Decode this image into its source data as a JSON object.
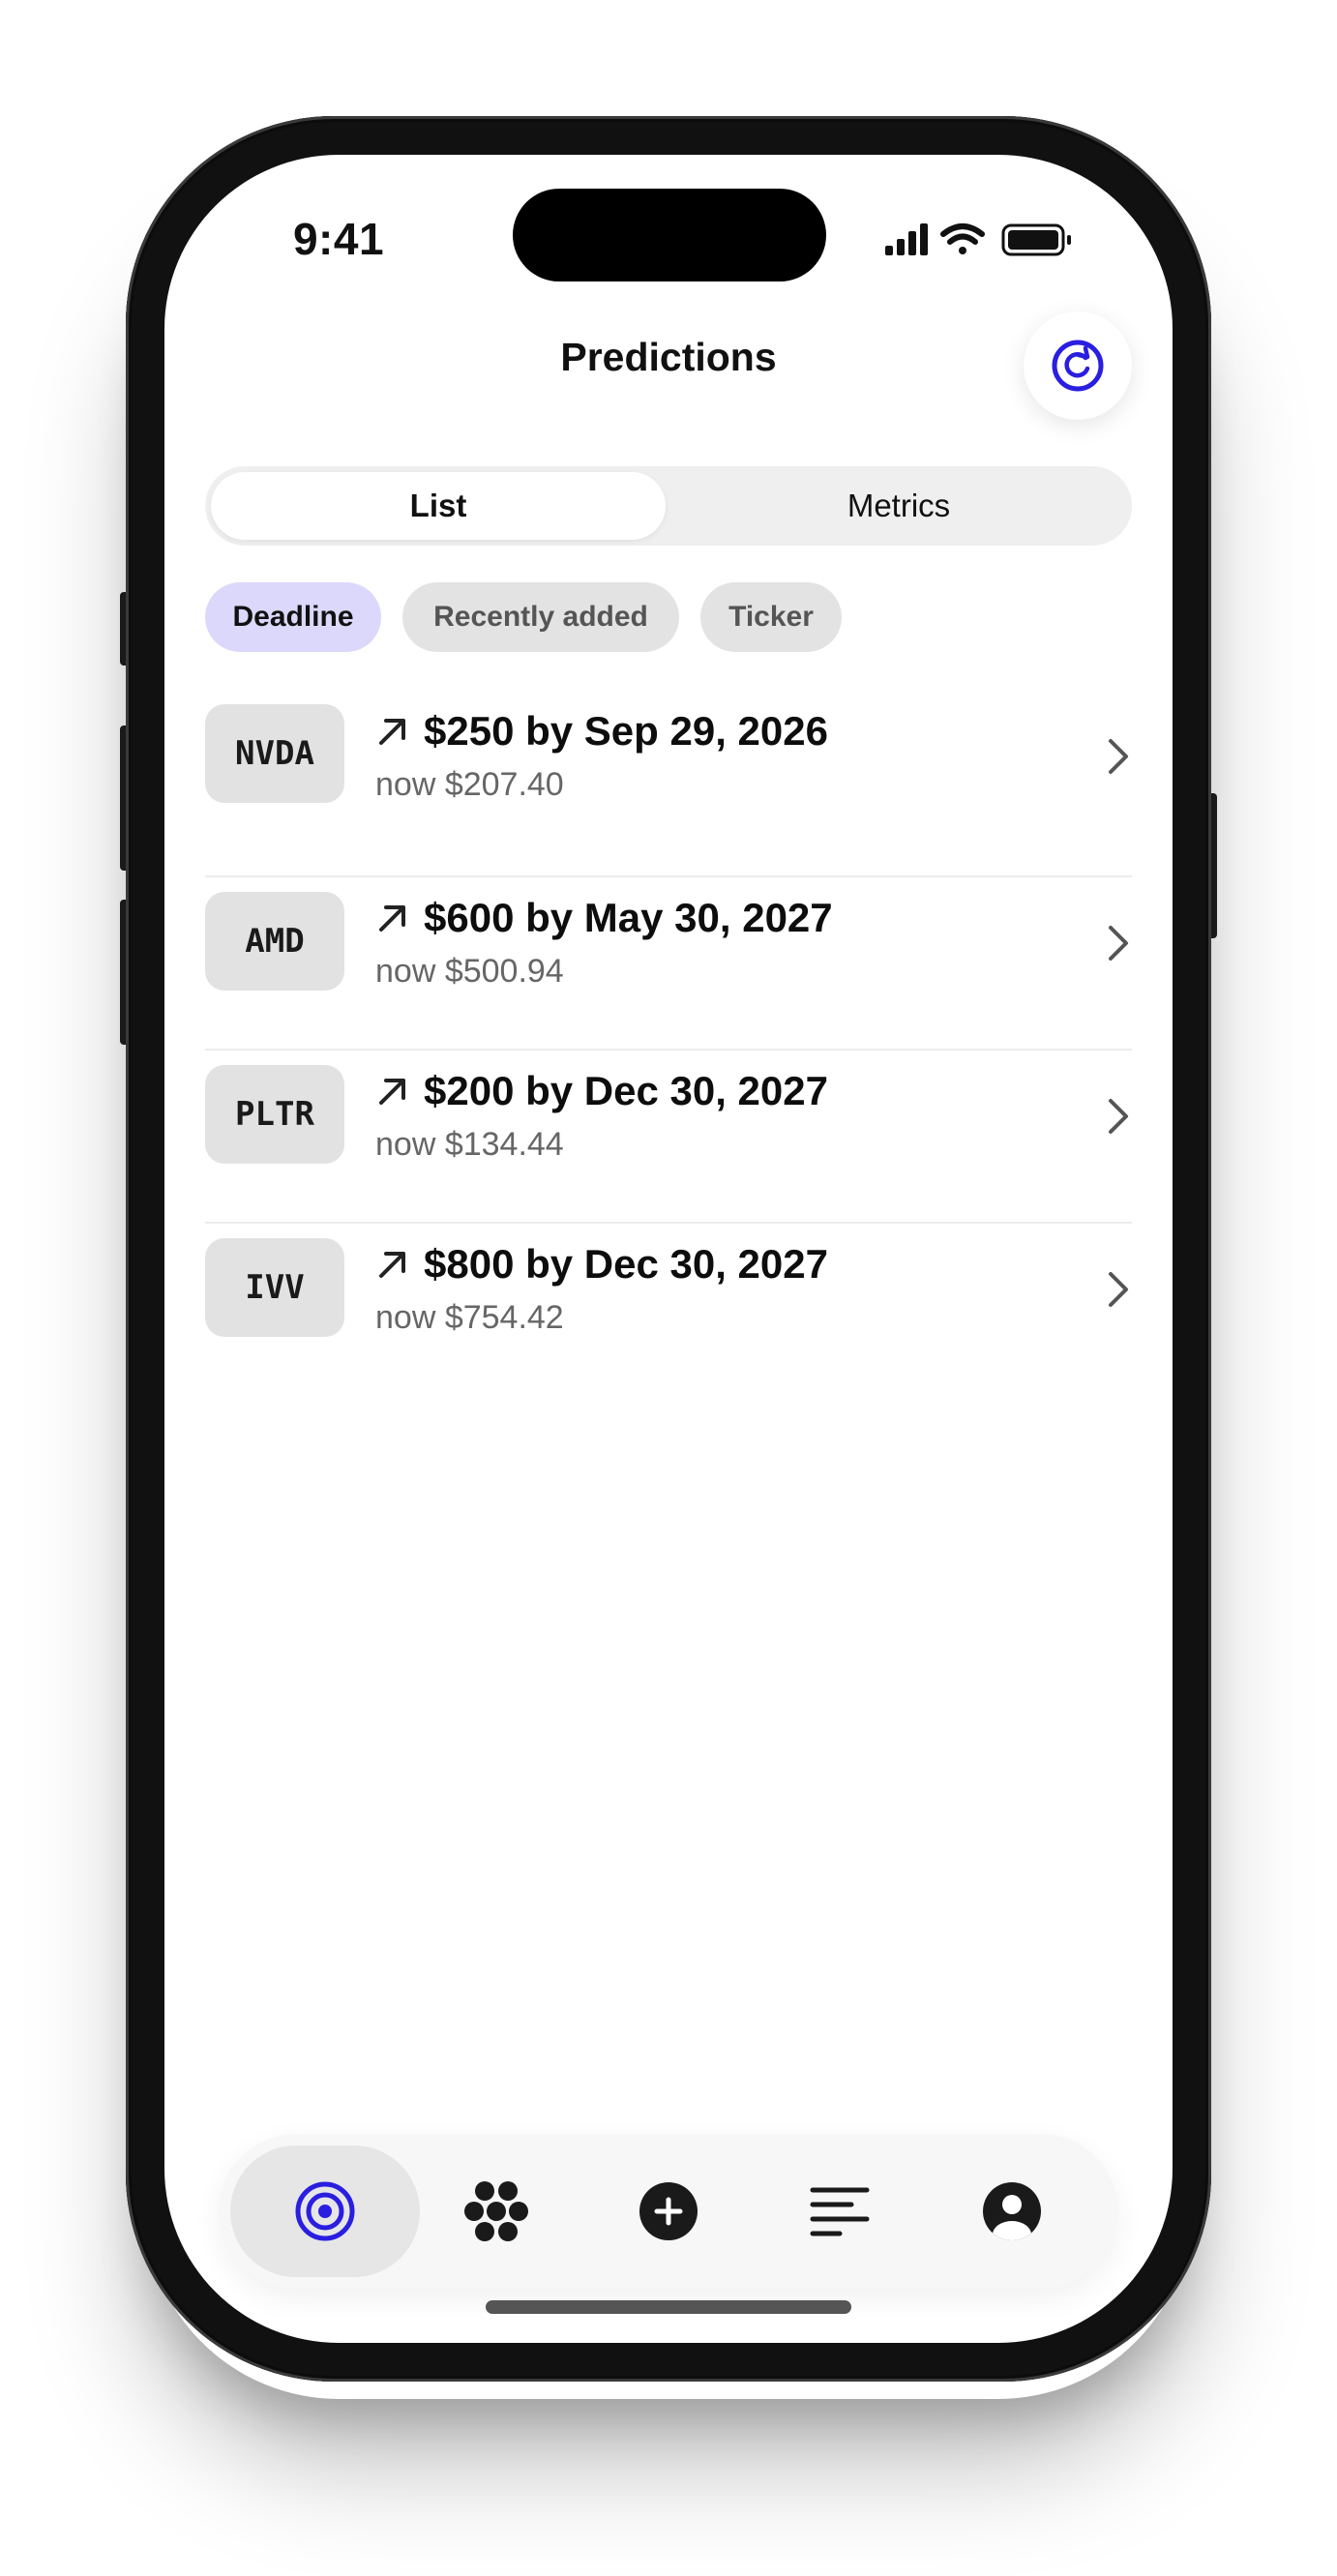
{
  "status_bar": {
    "time": "9:41"
  },
  "header": {
    "title": "Predictions"
  },
  "segments": [
    {
      "label": "List"
    },
    {
      "label": "Metrics"
    }
  ],
  "sort_chips": [
    {
      "label": "Deadline"
    },
    {
      "label": "Recently added"
    },
    {
      "label": "Ticker"
    }
  ],
  "predictions": [
    {
      "ticker": "NVDA",
      "target": "$250 by Sep 29, 2026",
      "now": "now $207.40"
    },
    {
      "ticker": "AMD",
      "target": "$600 by May 30, 2027",
      "now": "now $500.94"
    },
    {
      "ticker": "PLTR",
      "target": "$200 by Dec 30, 2027",
      "now": "now $134.44"
    },
    {
      "ticker": "IVV",
      "target": "$800 by Dec 30, 2027",
      "now": "now $754.42"
    }
  ],
  "tab_bar": [
    "target-icon",
    "grid-dots-icon",
    "add-circle-icon",
    "feed-lines-icon",
    "profile-icon"
  ],
  "colors": {
    "accent": "#2a1ee0",
    "chip_active": "#dcd8fb"
  }
}
